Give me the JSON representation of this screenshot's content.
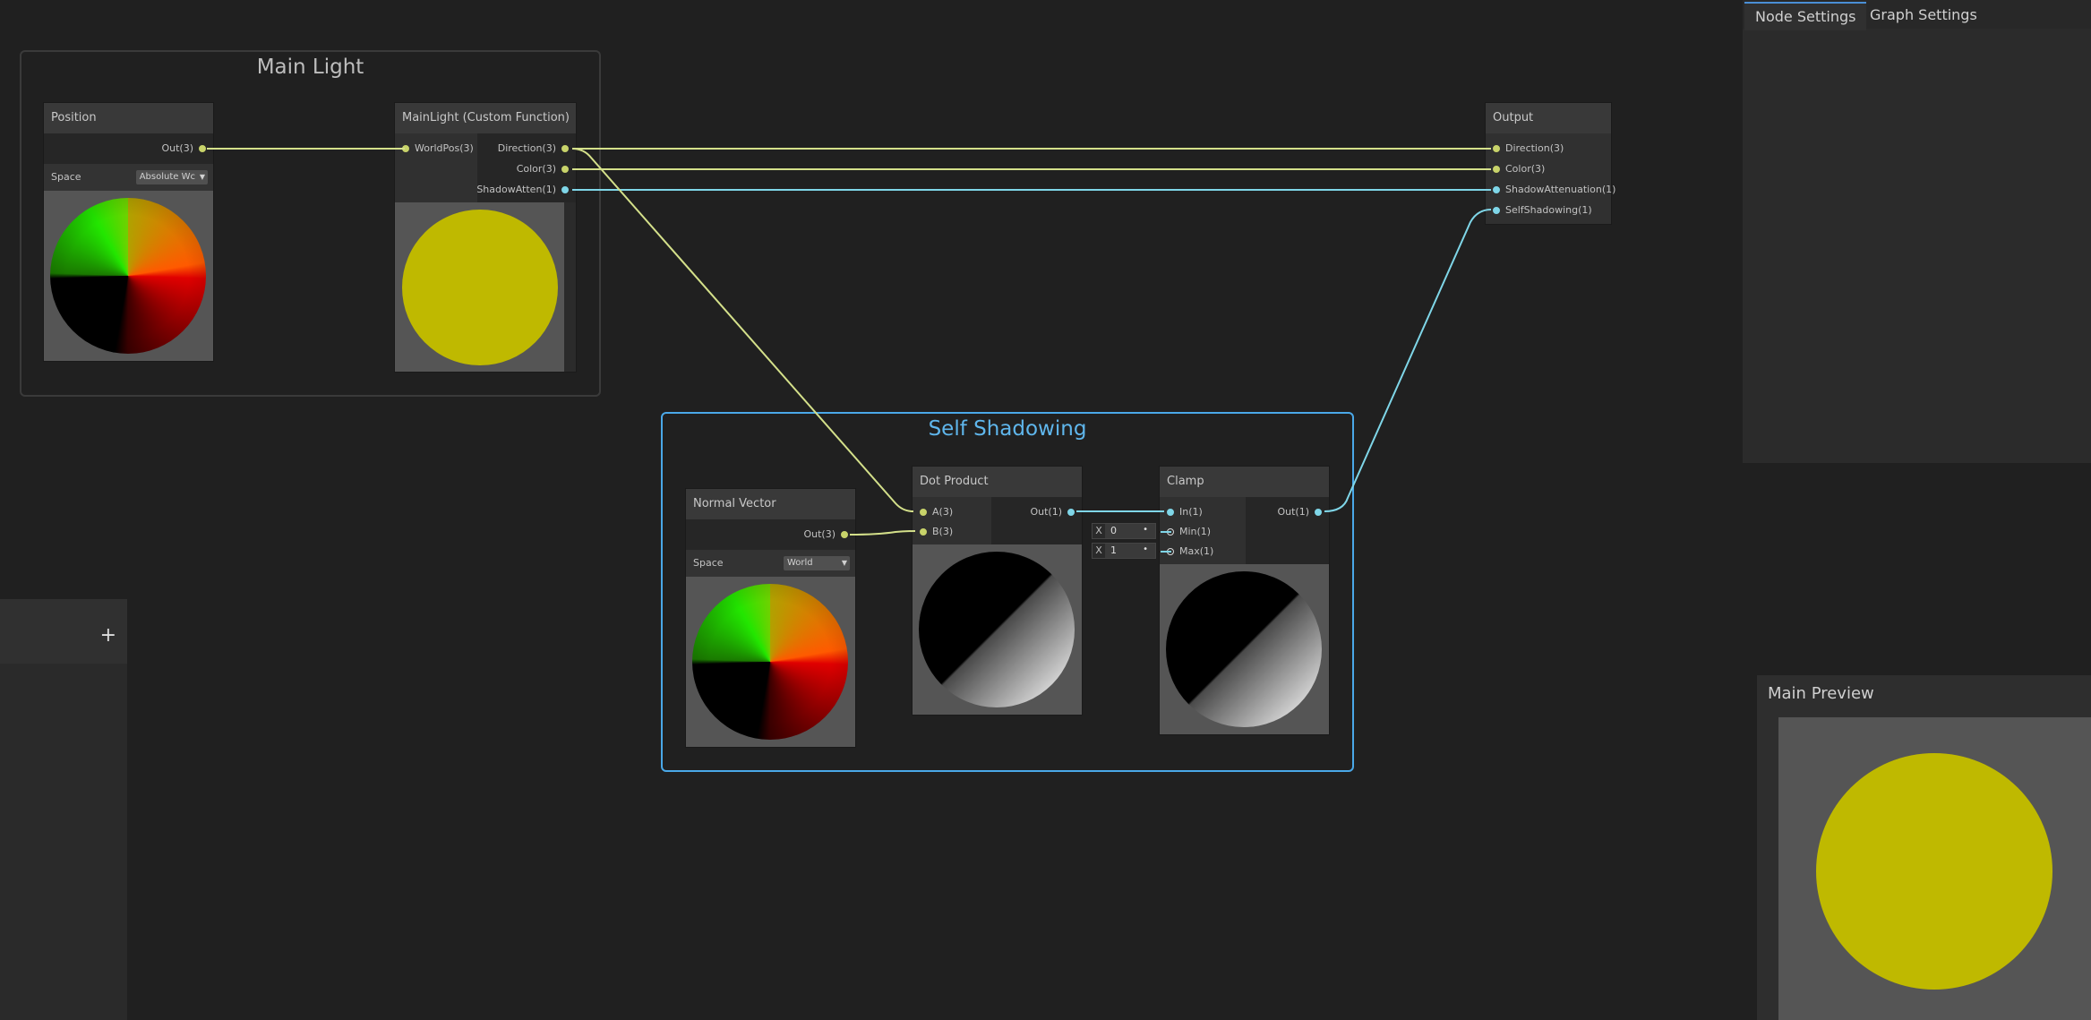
{
  "groups": {
    "main_light": {
      "title": "Main Light"
    },
    "self_shadowing": {
      "title": "Self Shadowing"
    }
  },
  "nodes": {
    "position": {
      "title": "Position",
      "out_label": "Out(3)",
      "space_label": "Space",
      "space_value": "Absolute Wc"
    },
    "main_light_fn": {
      "title": "MainLight (Custom Function)",
      "in_label": "WorldPos(3)",
      "outputs": [
        "Direction(3)",
        "Color(3)",
        "ShadowAtten(1)"
      ]
    },
    "output": {
      "title": "Output",
      "inputs": [
        "Direction(3)",
        "Color(3)",
        "ShadowAttenuation(1)",
        "SelfShadowing(1)"
      ]
    },
    "normal_vector": {
      "title": "Normal Vector",
      "out_label": "Out(3)",
      "space_label": "Space",
      "space_value": "World"
    },
    "dot_product": {
      "title": "Dot Product",
      "inputs": [
        "A(3)",
        "B(3)"
      ],
      "out_label": "Out(1)"
    },
    "clamp": {
      "title": "Clamp",
      "inputs": [
        "In(1)",
        "Min(1)",
        "Max(1)"
      ],
      "out_label": "Out(1)",
      "min_field": {
        "axis": "X",
        "value": "0"
      },
      "max_field": {
        "axis": "X",
        "value": "1"
      }
    }
  },
  "inspector": {
    "tabs": [
      "Node Settings",
      "Graph Settings"
    ],
    "active_tab": "Node Settings"
  },
  "blackboard": {
    "add_label": "+"
  },
  "main_preview": {
    "title": "Main Preview"
  },
  "colors": {
    "background": "#202020",
    "wire_vector": "#d4e08a",
    "wire_float": "#7fd6e8",
    "group_selected": "#4aa8e8",
    "preview_yellow": "#bfb900"
  }
}
